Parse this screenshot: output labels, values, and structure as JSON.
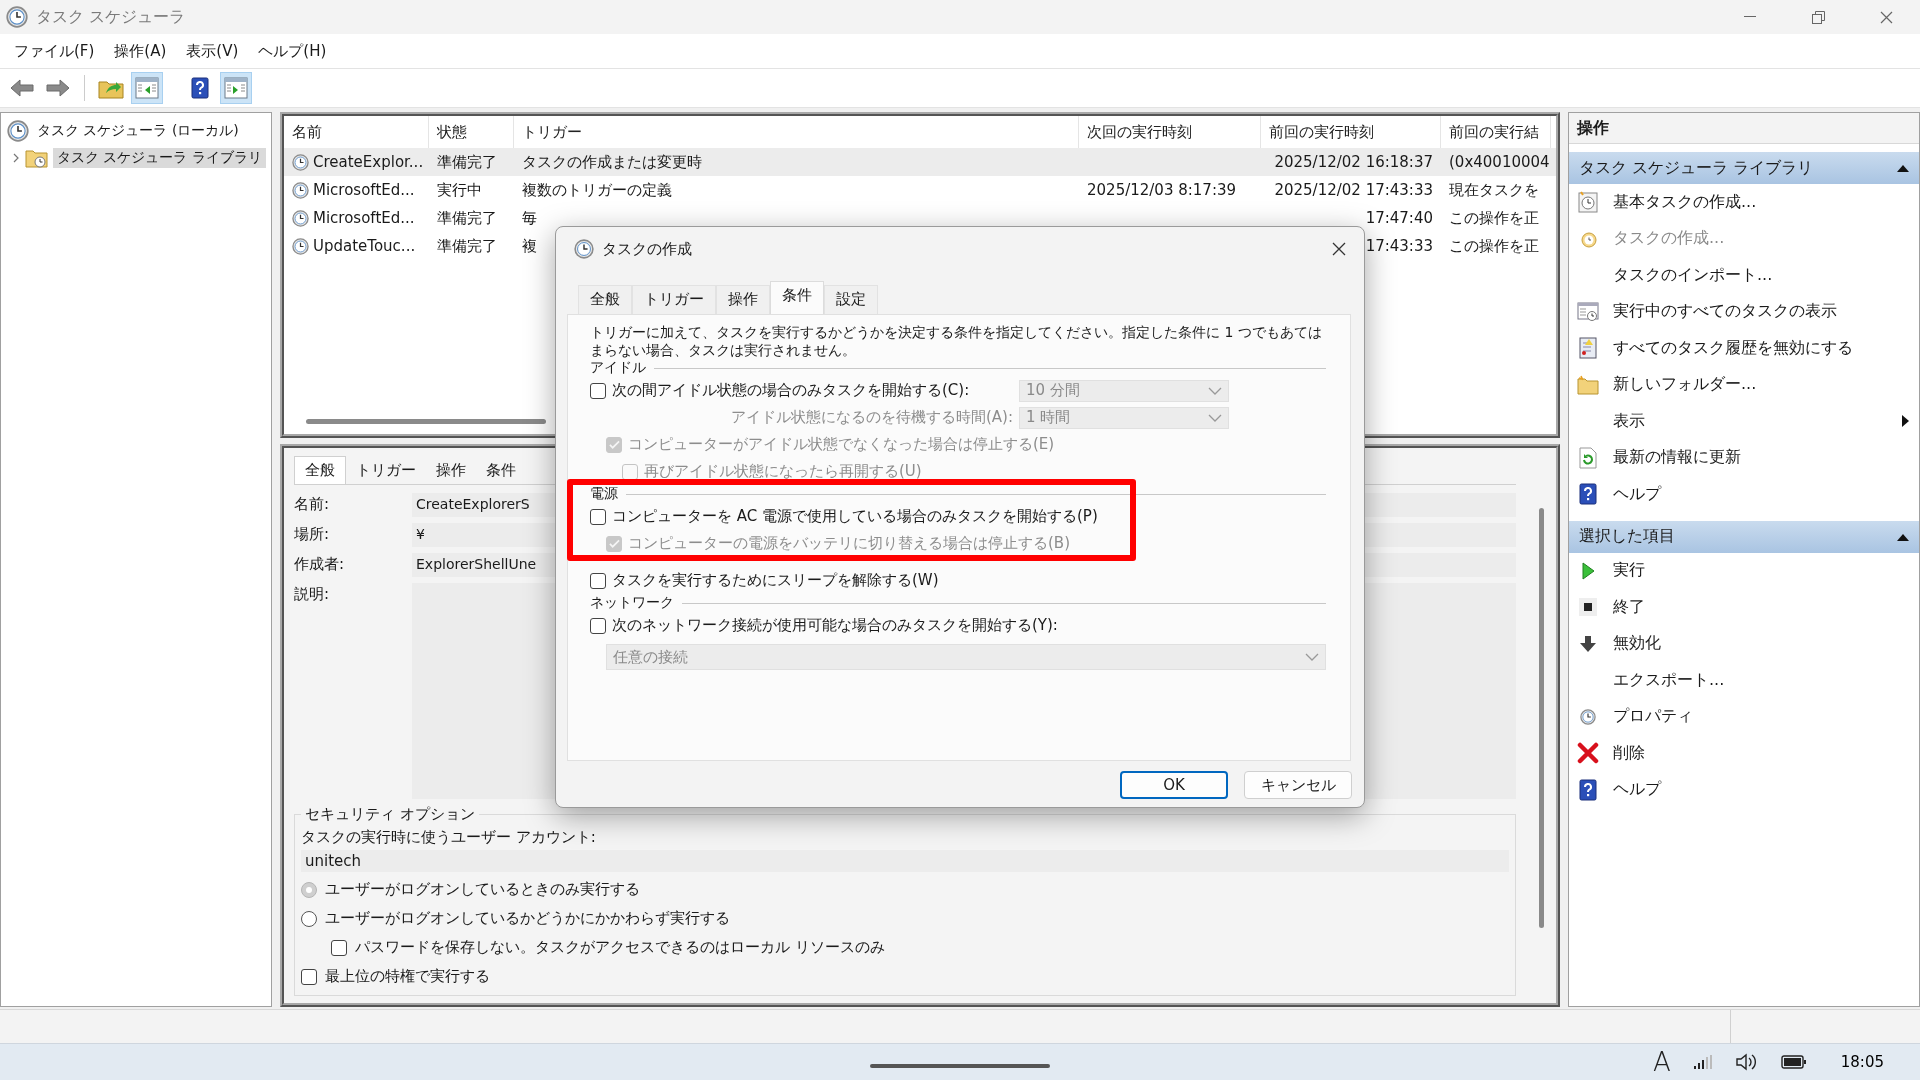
{
  "window": {
    "title": "タスク スケジューラ"
  },
  "menu": [
    "ファイル(F)",
    "操作(A)",
    "表示(V)",
    "ヘルプ(H)"
  ],
  "toolbar": {
    "console_tree_shown": true,
    "action_pane_shown": true
  },
  "tree": [
    {
      "label": "タスク スケジューラ (ローカル)",
      "selected": false,
      "children": [
        {
          "label": "タスク スケジューラ ライブラリ",
          "selected": true,
          "expanded": false
        }
      ]
    }
  ],
  "task_list": {
    "columns": [
      "名前",
      "状態",
      "トリガー",
      "次回の実行時刻",
      "前回の実行時刻",
      "前回の実行結"
    ],
    "rows": [
      {
        "selected": true,
        "cells": [
          "CreateExplor...",
          "準備完了",
          "タスクの作成または変更時",
          null,
          "2025/12/02 16:18:37",
          "(0x40010004"
        ]
      },
      {
        "selected": false,
        "cells": [
          "MicrosoftEd...",
          "実行中",
          "複数のトリガーの定義",
          "2025/12/03 8:17:39",
          "2025/12/02 17:43:33",
          "現在タスクを"
        ]
      },
      {
        "selected": false,
        "cells": [
          "MicrosoftEd...",
          "準備完了",
          "毎",
          null,
          "17:47:40",
          "この操作を正"
        ]
      },
      {
        "selected": false,
        "cells": [
          "UpdateTouc...",
          "準備完了",
          "複",
          null,
          "17:43:33",
          "この操作を正"
        ]
      }
    ]
  },
  "detail": {
    "tabs": [
      {
        "label": "全般",
        "selected": true
      },
      {
        "label": "トリガー",
        "selected": false
      },
      {
        "label": "操作",
        "selected": false
      },
      {
        "label": "条件",
        "selected": false
      }
    ],
    "fields": [
      {
        "kind": "text",
        "label": "名前:",
        "value": "CreateExplorerS"
      },
      {
        "kind": "text",
        "label": "場所:",
        "value": "¥"
      },
      {
        "kind": "text",
        "label": "作成者:",
        "value": "ExplorerShellUne"
      },
      {
        "kind": "textarea",
        "label": "説明:"
      }
    ],
    "security": {
      "title": "セキュリティ オプション",
      "account_label": "タスクの実行時に使うユーザー アカウント:",
      "account": "unitech",
      "options": [
        {
          "kind": "radio",
          "label": "ユーザーがログオンしているときのみ実行する",
          "selected": true
        },
        {
          "kind": "radio",
          "label": "ユーザーがログオンしているかどうかにかかわらず実行する",
          "selected": false,
          "children": [
            {
              "kind": "checkbox",
              "label": "パスワードを保存しない。タスクがアクセスできるのはローカル リソースのみ",
              "checked": false
            }
          ]
        },
        {
          "kind": "checkbox",
          "label": "最上位の特権で実行する",
          "checked": false
        }
      ]
    }
  },
  "actions": {
    "title": "操作",
    "sections": [
      {
        "title": "タスク スケジューラ ライブラリ",
        "expanded": true,
        "items": [
          {
            "label": "基本タスクの作成...",
            "kind": "command",
            "disabled": false
          },
          {
            "label": "タスクの作成...",
            "kind": "command",
            "disabled": true
          },
          {
            "label": "タスクのインポート...",
            "kind": "command",
            "disabled": false
          },
          {
            "label": "実行中のすべてのタスクの表示",
            "kind": "command",
            "disabled": false
          },
          {
            "label": "すべてのタスク履歴を無効にする",
            "kind": "command",
            "disabled": false
          },
          {
            "label": "新しいフォルダー...",
            "kind": "command",
            "disabled": false
          },
          {
            "label": "表示",
            "kind": "submenu",
            "disabled": false
          },
          {
            "label": "最新の情報に更新",
            "kind": "command",
            "disabled": false
          },
          {
            "label": "ヘルプ",
            "kind": "command",
            "disabled": false
          }
        ]
      },
      {
        "title": "選択した項目",
        "expanded": true,
        "items": [
          {
            "label": "実行",
            "kind": "command",
            "disabled": false
          },
          {
            "label": "終了",
            "kind": "command",
            "disabled": false
          },
          {
            "label": "無効化",
            "kind": "command",
            "disabled": false
          },
          {
            "label": "エクスポート...",
            "kind": "command",
            "disabled": false
          },
          {
            "label": "プロパティ",
            "kind": "command",
            "disabled": false
          },
          {
            "label": "削除",
            "kind": "command",
            "disabled": false
          },
          {
            "label": "ヘルプ",
            "kind": "command",
            "disabled": false
          }
        ]
      }
    ]
  },
  "dialog": {
    "title": "タスクの作成",
    "tabs": [
      {
        "label": "全般",
        "selected": false
      },
      {
        "label": "トリガー",
        "selected": false
      },
      {
        "label": "操作",
        "selected": false
      },
      {
        "label": "条件",
        "selected": true
      },
      {
        "label": "設定",
        "selected": false
      }
    ],
    "description": "トリガーに加えて、タスクを実行するかどうかを決定する条件を指定してください。指定した条件に 1 つでもあてはまらない場合、タスクは実行されません。",
    "groups": [
      {
        "label": "アイドル",
        "highlighted": false,
        "rows": [
          {
            "kind": "checkbox",
            "label": "次の間アイドル状態の場合のみタスクを開始する(C):",
            "checked": false,
            "disabled": false,
            "select": {
              "value": "10 分間",
              "disabled": true
            },
            "children": [
              {
                "kind": "field",
                "label": "アイドル状態になるのを待機する時間(A):",
                "disabled": true,
                "select": {
                  "value": "1 時間",
                  "disabled": true
                }
              },
              {
                "kind": "checkbox",
                "label": "コンピューターがアイドル状態でなくなった場合は停止する(E)",
                "checked": true,
                "disabled": true,
                "children": [
                  {
                    "kind": "checkbox",
                    "label": "再びアイドル状態になったら再開する(U)",
                    "checked": false,
                    "disabled": true
                  }
                ]
              }
            ]
          }
        ]
      },
      {
        "label": "電源",
        "highlighted": true,
        "rows": [
          {
            "kind": "checkbox",
            "label": "コンピューターを AC 電源で使用している場合のみタスクを開始する(P)",
            "checked": false,
            "disabled": false,
            "children": [
              {
                "kind": "checkbox",
                "label": "コンピューターの電源をバッテリに切り替える場合は停止する(B)",
                "checked": true,
                "disabled": true
              }
            ]
          },
          {
            "kind": "checkbox",
            "label": "タスクを実行するためにスリープを解除する(W)",
            "checked": false,
            "disabled": false
          }
        ]
      },
      {
        "label": "ネットワーク",
        "highlighted": false,
        "rows": [
          {
            "kind": "checkbox",
            "label": "次のネットワーク接続が使用可能な場合のみタスクを開始する(Y):",
            "checked": false,
            "disabled": false,
            "children": [
              {
                "kind": "select",
                "select": {
                  "value": "任意の接続",
                  "disabled": true
                }
              }
            ]
          }
        ]
      }
    ],
    "buttons": [
      {
        "label": "OK",
        "default": true
      },
      {
        "label": "キャンセル",
        "default": false
      }
    ]
  },
  "taskbar": {
    "ime": "A",
    "clock": "18:05"
  }
}
